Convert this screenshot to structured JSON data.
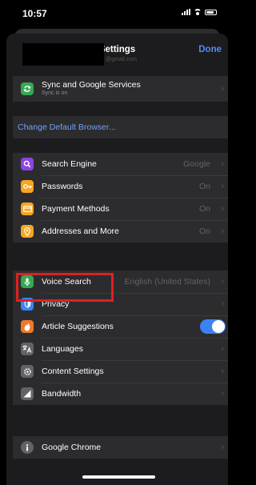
{
  "status": {
    "time": "10:57"
  },
  "nav": {
    "title": "Settings",
    "done": "Done"
  },
  "account": {
    "subtitle": "@gmail.com"
  },
  "sync": {
    "label": "Sync and Google Services",
    "sublabel": "Sync is on"
  },
  "default_browser": {
    "label": "Change Default Browser..."
  },
  "basics": [
    {
      "label": "Search Engine",
      "value": "Google",
      "icon": "search-icon",
      "color": "#8e44e0"
    },
    {
      "label": "Passwords",
      "value": "On",
      "icon": "key-icon",
      "color": "#f5a623"
    },
    {
      "label": "Payment Methods",
      "value": "On",
      "icon": "card-icon",
      "color": "#f5a623"
    },
    {
      "label": "Addresses and More",
      "value": "On",
      "icon": "location-pin-icon",
      "color": "#f5a623"
    }
  ],
  "advanced": [
    {
      "label": "Voice Search",
      "value": "English (United States)",
      "icon": "microphone-icon",
      "color": "#34a853"
    },
    {
      "label": "Privacy",
      "value": "",
      "icon": "shield-icon",
      "color": "#3b82f6"
    },
    {
      "label": "Article Suggestions",
      "value": "",
      "icon": "flame-icon",
      "color": "#f0782b",
      "toggle": true
    },
    {
      "label": "Languages",
      "value": "",
      "icon": "translate-icon",
      "color": "#636366"
    },
    {
      "label": "Content Settings",
      "value": "",
      "icon": "settings-icon",
      "color": "#636366"
    },
    {
      "label": "Bandwidth",
      "value": "",
      "icon": "bandwidth-icon",
      "color": "#636366"
    }
  ],
  "about": {
    "label": "Google Chrome",
    "icon": "info-icon",
    "color": "#636366"
  }
}
